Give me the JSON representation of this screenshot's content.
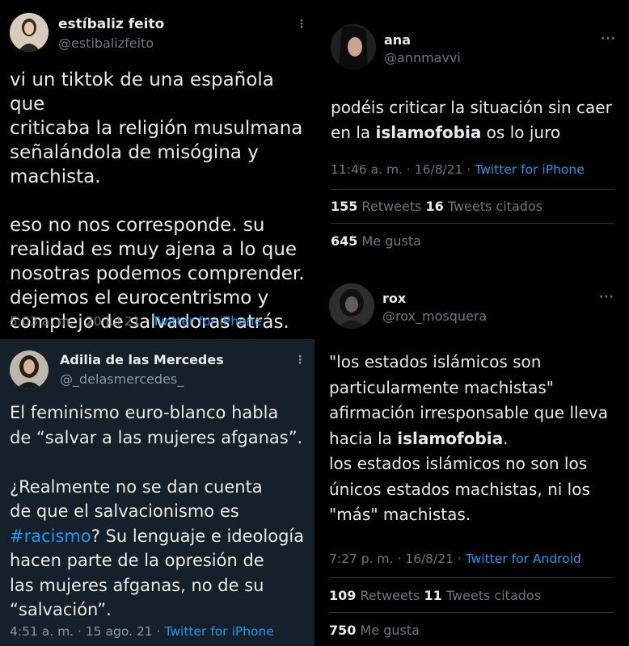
{
  "tweets": {
    "t1": {
      "name": "estíbaliz feito",
      "handle": "@estibalizfeito",
      "text": "vi un tiktok de una española que\ncriticaba la religión musulmana\nseñalándola de misógina y\nmachista.\n\neso no nos corresponde. su\nrealidad es muy ajena a lo que\nnosotras podemos comprender.\ndejemos el eurocentrismo y\ncomplejo de salvadoras atrás.",
      "time": "5:03 a. m. · 20 jul 21 · ",
      "source": "Twitter for iPhone"
    },
    "t2": {
      "name": "Adilia de las Mercedes",
      "handle": "@_delasmercedes_",
      "text_a": "El feminismo euro-blanco habla\nde “salvar a las mujeres afganas”.\n\n¿Realmente no se dan cuenta\nde que el salvacionismo es\n",
      "hashtag": "#racismo",
      "text_b": "? Su lenguaje e ideología\nhacen parte de la opresión de\nlas mujeres afganas, no de su\n“salvación”.",
      "time": "4:51 a. m. · 15 ago. 21 · ",
      "source": "Twitter for iPhone"
    },
    "t3": {
      "name": "ana",
      "handle": "@annmavvi",
      "text_a": "podéis criticar la situación sin caer\nen la ",
      "highlight": "islamofobia",
      "text_b": " os lo juro",
      "time": "11:46 a. m. · 16/8/21 · ",
      "source": "Twitter for iPhone",
      "retweets": "155",
      "retweets_label": " Retweets  ",
      "quotes": "16",
      "quotes_label": " Tweets citados",
      "likes": "645",
      "likes_label": " Me gusta"
    },
    "t4": {
      "name": "rox",
      "handle": "@rox_mosquera",
      "text_a": "\"los estados islámicos son\nparticularmente machistas\"\nafirmación irresponsable que lleva\nhacia la ",
      "highlight": "islamofobia",
      "text_b": ".\nlos estados islámicos no son los\núnicos estados machistas, ni los\n\"más\" machistas.",
      "time": "7:27 p. m. · 16/8/21 · ",
      "source": "Twitter for Android",
      "retweets": "109",
      "retweets_label": " Retweets  ",
      "quotes": "11",
      "quotes_label": " Tweets citados",
      "likes": "750",
      "likes_label": " Me gusta"
    }
  },
  "more_glyph": "···",
  "more_glyph_vertical": "⋮",
  "colors": {
    "background_dark": "#000000",
    "background_dim": "#15202b",
    "link": "#1d9bf0",
    "secondary": "#71767b",
    "text": "#e7e9ea"
  }
}
